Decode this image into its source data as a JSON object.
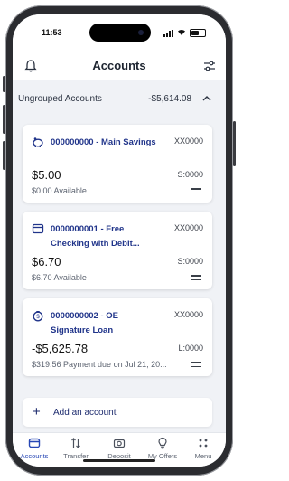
{
  "status": {
    "time": "11:53"
  },
  "header": {
    "title": "Accounts",
    "left_icon": "bell-icon",
    "right_icon": "sliders-icon"
  },
  "group": {
    "title": "Ungrouped Accounts",
    "total": "-$5,614.08"
  },
  "accounts": [
    {
      "name": "000000000 - Main Savings",
      "mask": "XX0000",
      "balance": "$5.00",
      "available": "$0.00 Available",
      "code": "S:0000",
      "icon": "piggy-bank-icon"
    },
    {
      "name": "0000000001 - Free Checking with Debit...",
      "mask": "XX0000",
      "balance": "$6.70",
      "available": "$6.70 Available",
      "code": "S:0000",
      "icon": "wallet-icon"
    },
    {
      "name": "0000000002 - OE Signature Loan",
      "mask": "XX0000",
      "balance": "-$5,625.78",
      "available": "$319.56 Payment due on Jul 21, 20...",
      "code": "L:0000",
      "icon": "money-bag-icon"
    }
  ],
  "add_account": {
    "label": "Add an account"
  },
  "tabs": [
    {
      "label": "Accounts",
      "icon": "wallet-icon",
      "active": true
    },
    {
      "label": "Transfer",
      "icon": "transfer-arrows-icon"
    },
    {
      "label": "Deposit",
      "icon": "camera-icon"
    },
    {
      "label": "My Offers",
      "icon": "lightbulb-icon"
    },
    {
      "label": "Menu",
      "icon": "dots-grid-icon"
    }
  ],
  "colors": {
    "accent": "#2747b5",
    "account_name": "#20348a",
    "background": "#f0f2f6"
  }
}
